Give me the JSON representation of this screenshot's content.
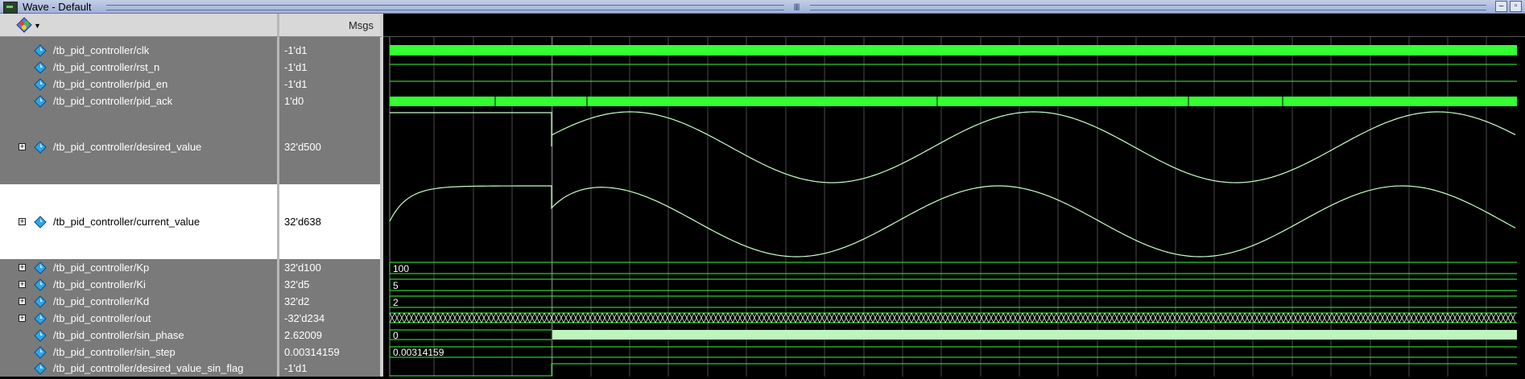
{
  "window": {
    "title": "Wave - Default",
    "minimize_label": "–",
    "restore_label": "▫"
  },
  "header": {
    "msgs_label": "Msgs",
    "tool_icon": "wave-tool-icon",
    "dropdown_icon": "chevron-down-icon"
  },
  "signals": [
    {
      "name": "/tb_pid_controller/clk",
      "value": "-1'd1",
      "expandable": false
    },
    {
      "name": "/tb_pid_controller/rst_n",
      "value": "-1'd1",
      "expandable": false
    },
    {
      "name": "/tb_pid_controller/pid_en",
      "value": "-1'd1",
      "expandable": false
    },
    {
      "name": "/tb_pid_controller/pid_ack",
      "value": "1'd0",
      "expandable": false
    },
    {
      "name": "/tb_pid_controller/desired_value",
      "value": "32'd500",
      "expandable": true
    },
    {
      "name": "/tb_pid_controller/current_value",
      "value": "32'd638",
      "expandable": true,
      "selected": true
    },
    {
      "name": "/tb_pid_controller/Kp",
      "value": "32'd100",
      "expandable": true
    },
    {
      "name": "/tb_pid_controller/Ki",
      "value": "32'd5",
      "expandable": true
    },
    {
      "name": "/tb_pid_controller/Kd",
      "value": "32'd2",
      "expandable": true
    },
    {
      "name": "/tb_pid_controller/out",
      "value": "-32'd234",
      "expandable": true
    },
    {
      "name": "/tb_pid_controller/sin_phase",
      "value": "2.62009",
      "expandable": false
    },
    {
      "name": "/tb_pid_controller/sin_step",
      "value": "0.00314159",
      "expandable": false
    },
    {
      "name": "/tb_pid_controller/desired_value_sin_flag",
      "value": "-1'd1",
      "expandable": false
    }
  ],
  "wave_labels": {
    "kp": "100",
    "ki": "5",
    "kd": "2",
    "sin_phase": "0",
    "sin_step": "0.00314159"
  },
  "colors": {
    "wave_green": "#33ff33",
    "analog_line": "#c8ffc8",
    "bus_fill": "#bdf5bd",
    "cursor_line": "#6a6a6a",
    "pane_gray": "#7a7a7a",
    "selected_row": "#ffffff"
  }
}
